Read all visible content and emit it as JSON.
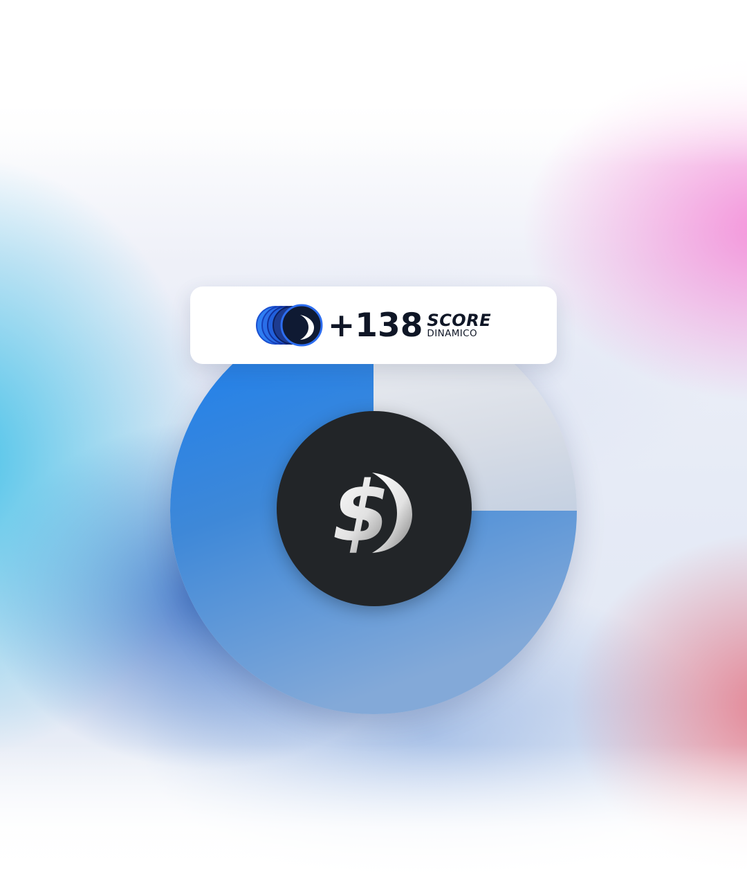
{
  "score_card": {
    "value": "+138",
    "title": "SCORE",
    "subtitle": "DINAMICO",
    "icon": "moon-coin-stack-icon"
  },
  "gauge": {
    "progress_fraction": 0.75,
    "filled_color": "#1f7fe6",
    "remainder_color": "#dfe3ea",
    "center_icon": "dollar-moon-logo-icon"
  },
  "colors": {
    "card_background": "#ffffff",
    "text_dark": "#0f1626",
    "center_disc": "#222528",
    "accent_blue": "#1e6fe6"
  }
}
